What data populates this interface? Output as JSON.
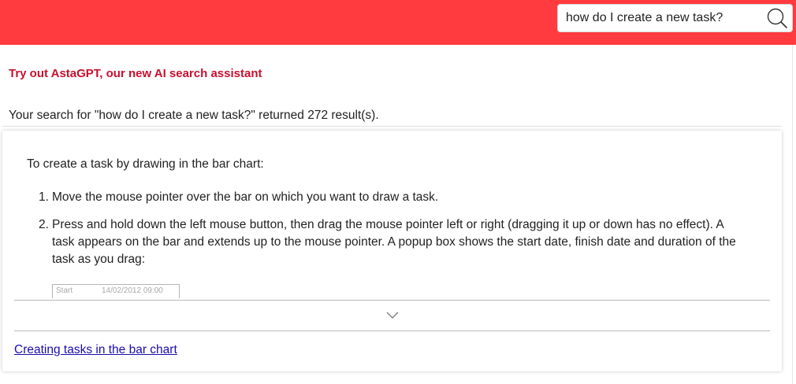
{
  "header": {
    "accent_color": "#ff3b3f",
    "search": {
      "value": "how do I create a new task?",
      "placeholder": "",
      "button_icon": "search-icon"
    }
  },
  "promo": {
    "text": "Try out AstaGPT, our new AI search assistant",
    "color": "#c8102e"
  },
  "results_summary": "Your search for \"how do I create a new task?\" returned 272 result(s).",
  "results": [
    {
      "snippet": {
        "intro": "To create a task by drawing in the bar chart:",
        "steps": [
          {
            "number": "1.",
            "text": "Move the mouse pointer over the bar on which you want to draw a task."
          },
          {
            "number": "2.",
            "text": "Press and hold down the left mouse button, then drag the mouse pointer left or right (dragging it up or down has no effect). A task appears on the bar and extends up to the mouse pointer. A popup box shows the start date, finish date and duration of the task as you drag:"
          }
        ],
        "popup_preview": {
          "label": "Start",
          "value": "14/02/2012 09:00"
        }
      },
      "expand_icon": "chevron-down-icon",
      "link_text": "Creating tasks in the bar chart"
    }
  ]
}
